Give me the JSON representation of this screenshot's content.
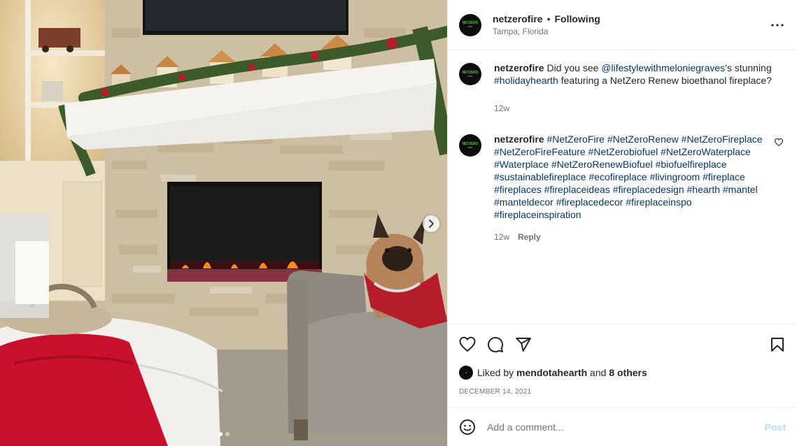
{
  "post": {
    "media": {
      "alt": "Photo of a fireplace with a dog",
      "slide_count": 2,
      "active_slide": 1,
      "next_icon": "chevron-right-icon"
    },
    "header": {
      "username": "netzerofire",
      "separator": "•",
      "follow_status": "Following",
      "location": "Tampa, Florida",
      "avatar_text": "NETZERO",
      "avatar_subtext": "FIRE",
      "more_icon": "more-horizontal-icon"
    },
    "caption": {
      "username": "netzerofire",
      "text_before": " Did you see ",
      "mention": "@lifestylewithmeloniegraves",
      "text_middle": "'s stunning ",
      "hashtag": "#holidayhearth",
      "text_after": " featuring a NetZero Renew bioethanol fireplace?",
      "time": "12w"
    },
    "comments": [
      {
        "username": "netzerofire",
        "hashtags": [
          "#NetZeroFire",
          "#NetZeroRenew",
          "#NetZeroFireplace",
          "#NetZeroFireFeature",
          "#NetZerobiofuel",
          "#NetZeroWaterplace",
          "#Waterplace",
          "#NetZeroRenewBiofuel",
          "#biofuelfireplace",
          "#sustainablefireplace",
          "#ecofireplace",
          "#livingroom",
          "#fireplace",
          "#fireplaces",
          "#fireplaceideas",
          "#fireplacedesign",
          "#hearth",
          "#mantel",
          "#manteldecor",
          "#fireplacedecor",
          "#fireplaceinspo",
          "#fireplaceinspiration"
        ],
        "time": "12w",
        "reply_label": "Reply",
        "like_icon": "heart-outline-icon"
      }
    ],
    "actions": {
      "like_icon": "heart-outline-icon",
      "comment_icon": "comment-bubble-icon",
      "share_icon": "paper-plane-icon",
      "save_icon": "bookmark-icon"
    },
    "likes": {
      "prefix": "Liked by ",
      "user": "mendotahearth",
      "joiner": " and ",
      "others": "8 others"
    },
    "date": "DECEMBER 14, 2021",
    "add_comment": {
      "placeholder": "Add a comment...",
      "post_label": "Post",
      "emoji_icon": "emoji-smile-icon"
    }
  }
}
